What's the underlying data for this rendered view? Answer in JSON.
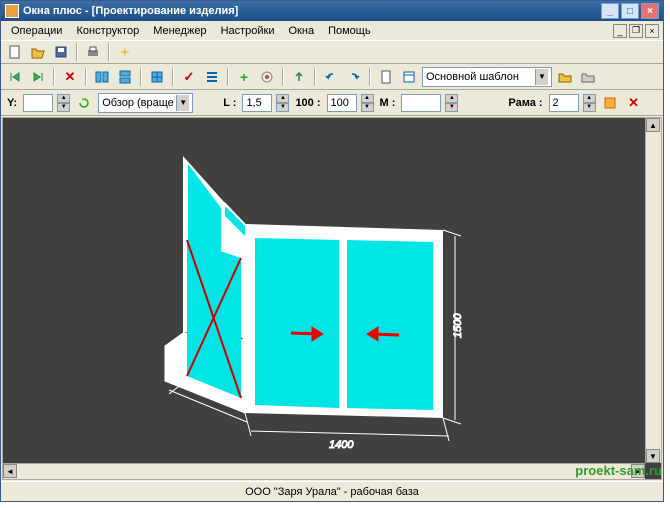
{
  "title": "Окна плюс - [Проектирование изделия]",
  "menu": [
    "Операции",
    "Конструктор",
    "Менеджер",
    "Настройки",
    "Окна",
    "Помощь"
  ],
  "template_combo": "Основной шаблон",
  "view_combo": "Обзор (враще",
  "params": {
    "y_label": "Y:",
    "y_value": "",
    "l_label": "L :",
    "l_value": "1,5",
    "scale_label": "100 :",
    "scale_value": "100",
    "m_label": "M :",
    "m_value": "",
    "frame_label": "Рама :",
    "frame_value": "2"
  },
  "dimensions": {
    "width": "1400",
    "height": "1500"
  },
  "statusbar": "ООО \"Заря Урала\" - рабочая база",
  "watermark": "proekt-sam.ru"
}
